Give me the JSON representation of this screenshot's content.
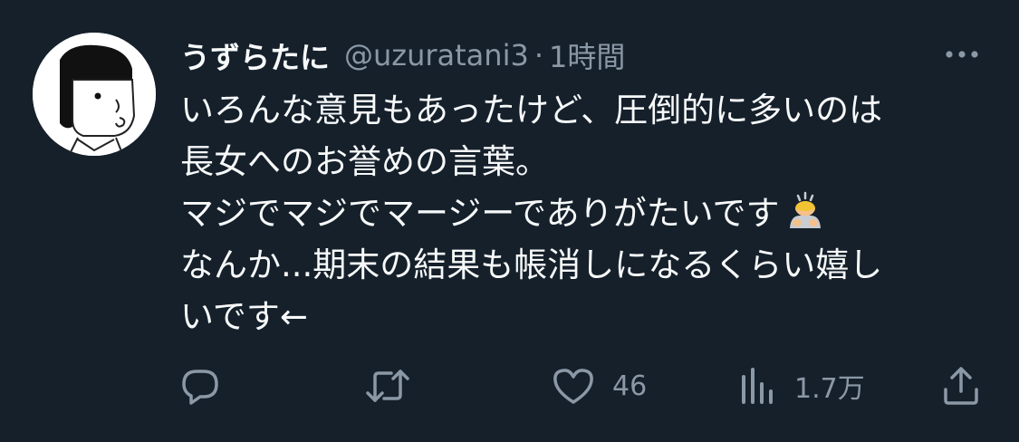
{
  "tweet": {
    "display_name": "うずらたに",
    "handle": "@uzuratani3",
    "separator": "·",
    "timestamp": "1時間",
    "lines": [
      "いろんな意見もあったけど、圧倒的に多いのは",
      "長女へのお誉めの言葉。",
      "マジでマジでマージーでありがたいです",
      "なんか...期末の結果も帳消しになるくらい嬉し",
      "いです←"
    ],
    "emoji": "person-bowing-emoji"
  },
  "actions": {
    "reply_icon": "reply-icon",
    "retweet_icon": "retweet-icon",
    "like_icon": "heart-icon",
    "like_count": "46",
    "views_icon": "views-icon",
    "view_count": "1.7万",
    "share_icon": "share-icon"
  },
  "colors": {
    "background": "#15202b",
    "text": "#f7f9f9",
    "secondary": "#8b98a5"
  }
}
